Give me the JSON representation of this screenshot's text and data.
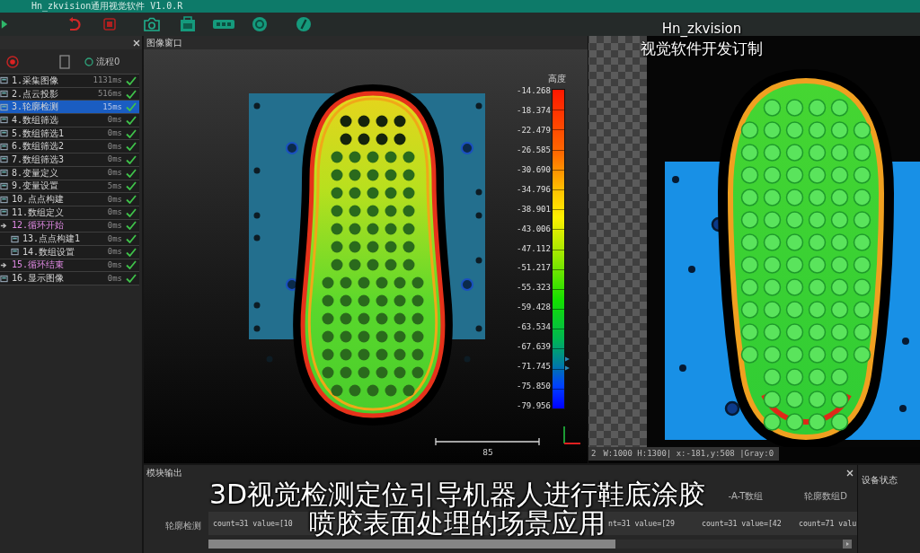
{
  "window": {
    "title": "Hn_zkvision通用视觉软件 V1.0.R"
  },
  "flow_panel": {
    "flow_option": {
      "label": "流程0",
      "selected": false
    },
    "steps": [
      {
        "label": "1.采集图像",
        "time": "1131ms",
        "passed": true,
        "selected": false,
        "kind": "step"
      },
      {
        "label": "2.点云投影",
        "time": "516ms",
        "passed": true,
        "selected": false,
        "kind": "step"
      },
      {
        "label": "3.轮廓检测",
        "time": "15ms",
        "passed": true,
        "selected": true,
        "kind": "step"
      },
      {
        "label": "4.数组筛选",
        "time": "0ms",
        "passed": true,
        "selected": false,
        "kind": "step"
      },
      {
        "label": "5.数组筛选1",
        "time": "0ms",
        "passed": true,
        "selected": false,
        "kind": "step"
      },
      {
        "label": "6.数组筛选2",
        "time": "0ms",
        "passed": true,
        "selected": false,
        "kind": "step"
      },
      {
        "label": "7.数组筛选3",
        "time": "0ms",
        "passed": true,
        "selected": false,
        "kind": "step"
      },
      {
        "label": "8.变量定义",
        "time": "0ms",
        "passed": true,
        "selected": false,
        "kind": "step"
      },
      {
        "label": "9.变量设置",
        "time": "5ms",
        "passed": true,
        "selected": false,
        "kind": "step"
      },
      {
        "label": "10.点点构建",
        "time": "0ms",
        "passed": true,
        "selected": false,
        "kind": "step"
      },
      {
        "label": "11.数组定义",
        "time": "0ms",
        "passed": true,
        "selected": false,
        "kind": "step"
      },
      {
        "label": "12.循环开始",
        "time": "0ms",
        "passed": true,
        "selected": false,
        "kind": "loop",
        "children": [
          {
            "label": "13.点点构建1",
            "time": "0ms",
            "passed": true,
            "selected": false,
            "kind": "step"
          },
          {
            "label": "14.数组设置",
            "time": "0ms",
            "passed": true,
            "selected": false,
            "kind": "step"
          }
        ]
      },
      {
        "label": "15.循环结束",
        "time": "0ms",
        "passed": true,
        "selected": false,
        "kind": "loop"
      },
      {
        "label": "16.显示图像",
        "time": "0ms",
        "passed": true,
        "selected": false,
        "kind": "step"
      }
    ]
  },
  "image_window": {
    "title": "图像窗口",
    "legend": {
      "title": "高度",
      "ticks": [
        "-14.268",
        "-18.374",
        "-22.479",
        "-26.585",
        "-30.690",
        "-34.796",
        "-38.901",
        "-43.006",
        "-47.112",
        "-51.217",
        "-55.323",
        "-59.428",
        "-63.534",
        "-67.639",
        "-71.745",
        "-75.850",
        "-79.956"
      ]
    },
    "scale_label": "85"
  },
  "scan_view": {
    "status_index": "2",
    "status": "W:1000 H:1300| x:-181,y:508 |Gray:0"
  },
  "output_panel": {
    "title": "模块输出",
    "columns": [
      null,
      null,
      null,
      null,
      null,
      "-A-T数组",
      "轮廓数组D"
    ],
    "rows": [
      {
        "label": "轮廓检测",
        "cells": [
          "count=31 value=[10",
          null,
          null,
          null,
          "nt=31 value=[29",
          "count=31 value=[42",
          "count=71 valu"
        ]
      }
    ]
  },
  "device_panel": {
    "title": "设备状态"
  },
  "overlay": {
    "brand": "Hn_zkvision",
    "tagline": "视觉软件开发订制",
    "subtitles": [
      "3D视觉检测定位引导机器人进行鞋底涂胶",
      "喷胶表面处理的场景应用"
    ]
  }
}
